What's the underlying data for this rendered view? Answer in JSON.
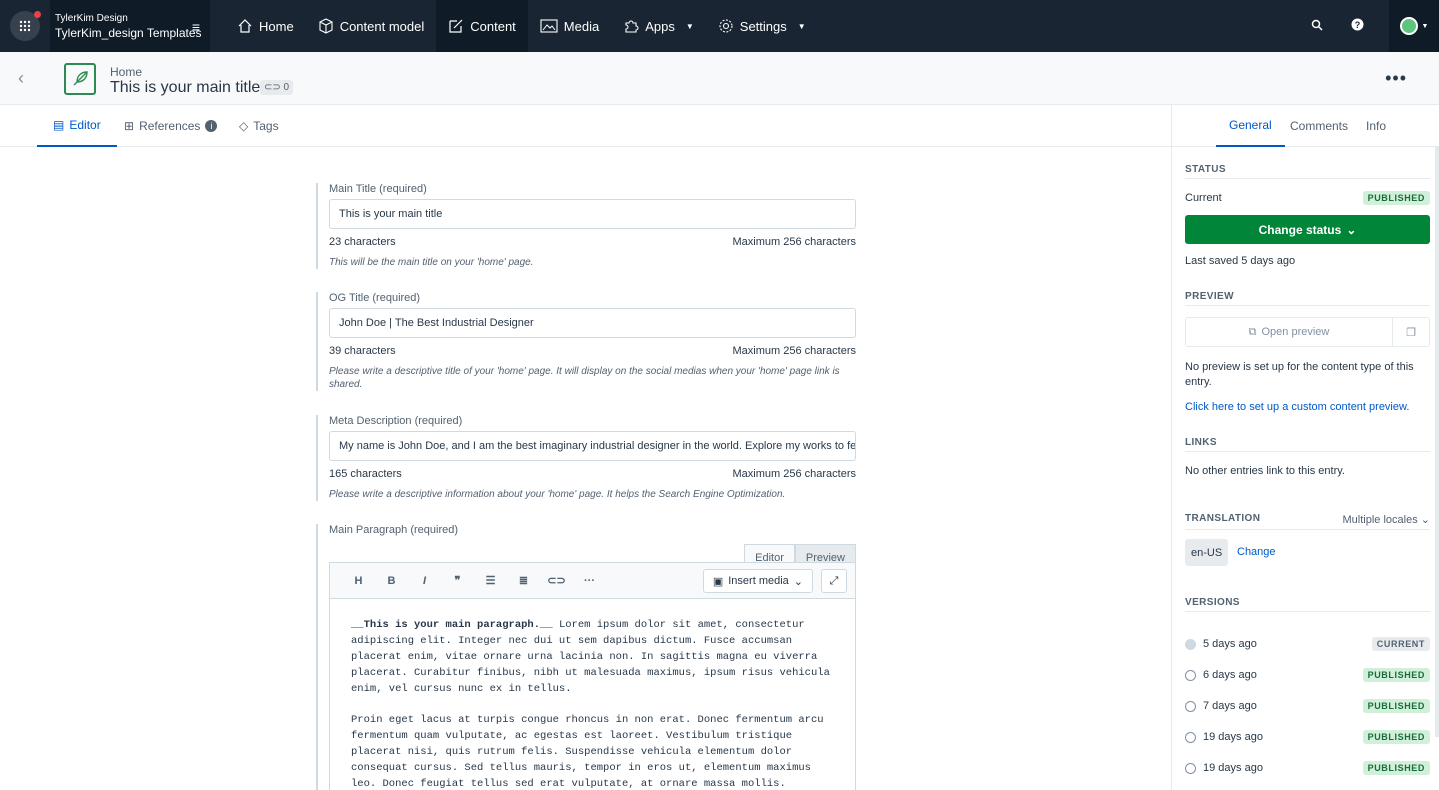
{
  "topnav": {
    "org": "TylerKim Design",
    "space": "TylerKim_design Templates",
    "items": [
      {
        "label": "Home"
      },
      {
        "label": "Content model"
      },
      {
        "label": "Content"
      },
      {
        "label": "Media"
      },
      {
        "label": "Apps"
      },
      {
        "label": "Settings"
      }
    ]
  },
  "header": {
    "breadcrumb": "Home",
    "title": "This is your main title",
    "links_count": "0"
  },
  "tabs": {
    "editor": "Editor",
    "references": "References",
    "tags": "Tags"
  },
  "fields": {
    "main_title": {
      "label": "Main Title (required)",
      "value": "This is your main title",
      "count": "23 characters",
      "max": "Maximum 256 characters",
      "help": "This will be the main title on your 'home' page."
    },
    "og_title": {
      "label": "OG Title (required)",
      "value": "John Doe | The Best Industrial Designer",
      "count": "39 characters",
      "max": "Maximum 256 characters",
      "help": "Please write a descriptive title of your 'home' page. It will display on the social medias when your 'home' page link is shared."
    },
    "meta": {
      "label": "Meta Description (required)",
      "value": "My name is John Doe, and  I am the best imaginary industrial designer in the world. Explore my works to feel r",
      "count": "165 characters",
      "max": "Maximum 256 characters",
      "help": "Please write a descriptive information about your 'home' page. It helps the Search Engine Optimization."
    },
    "paragraph": {
      "label": "Main Paragraph (required)",
      "mode_editor": "Editor",
      "mode_preview": "Preview",
      "toolbar": {
        "heading": "H",
        "bold": "B",
        "italic": "I",
        "quote": "❞",
        "insert_media": "Insert media"
      },
      "p1_bold": "__This is your main paragraph.__",
      "p1_rest": " Lorem ipsum dolor sit amet, consectetur adipiscing elit. Integer nec dui ut sem dapibus dictum. Fusce accumsan placerat enim, vitae ornare urna lacinia non. In sagittis magna eu viverra placerat. Curabitur finibus, nibh ut malesuada maximus, ipsum risus vehicula enim, vel cursus nunc ex in tellus.",
      "p2": "Proin eget lacus at turpis congue rhoncus in non erat. Donec fermentum arcu fermentum quam vulputate, ac egestas est laoreet. Vestibulum tristique placerat nisi, quis rutrum felis. Suspendisse vehicula elementum dolor consequat cursus. Sed tellus mauris, tempor in eros ut, elementum maximus leo. Donec feugiat tellus sed erat vulputate, at ornare massa mollis."
    }
  },
  "sidebar": {
    "tabs": {
      "general": "General",
      "comments": "Comments",
      "info": "Info"
    },
    "status": {
      "heading": "STATUS",
      "current_label": "Current",
      "badge": "PUBLISHED",
      "button": "Change status",
      "last_saved": "Last saved 5 days ago"
    },
    "preview": {
      "heading": "PREVIEW",
      "open": "Open preview",
      "note": "No preview is set up for the content type of this entry.",
      "link": "Click here to set up a custom content preview."
    },
    "links": {
      "heading": "LINKS",
      "note": "No other entries link to this entry."
    },
    "translation": {
      "heading": "TRANSLATION",
      "mode": "Multiple locales",
      "locale": "en-US",
      "change": "Change"
    },
    "versions": {
      "heading": "VERSIONS",
      "items": [
        {
          "when": "5 days ago",
          "badge": "CURRENT"
        },
        {
          "when": "6 days ago",
          "badge": "PUBLISHED"
        },
        {
          "when": "7 days ago",
          "badge": "PUBLISHED"
        },
        {
          "when": "19 days ago",
          "badge": "PUBLISHED"
        },
        {
          "when": "19 days ago",
          "badge": "PUBLISHED"
        }
      ]
    }
  },
  "colors": {
    "nav_bg": "#192532",
    "accent": "#0059c8",
    "publish_green": "#008539"
  }
}
